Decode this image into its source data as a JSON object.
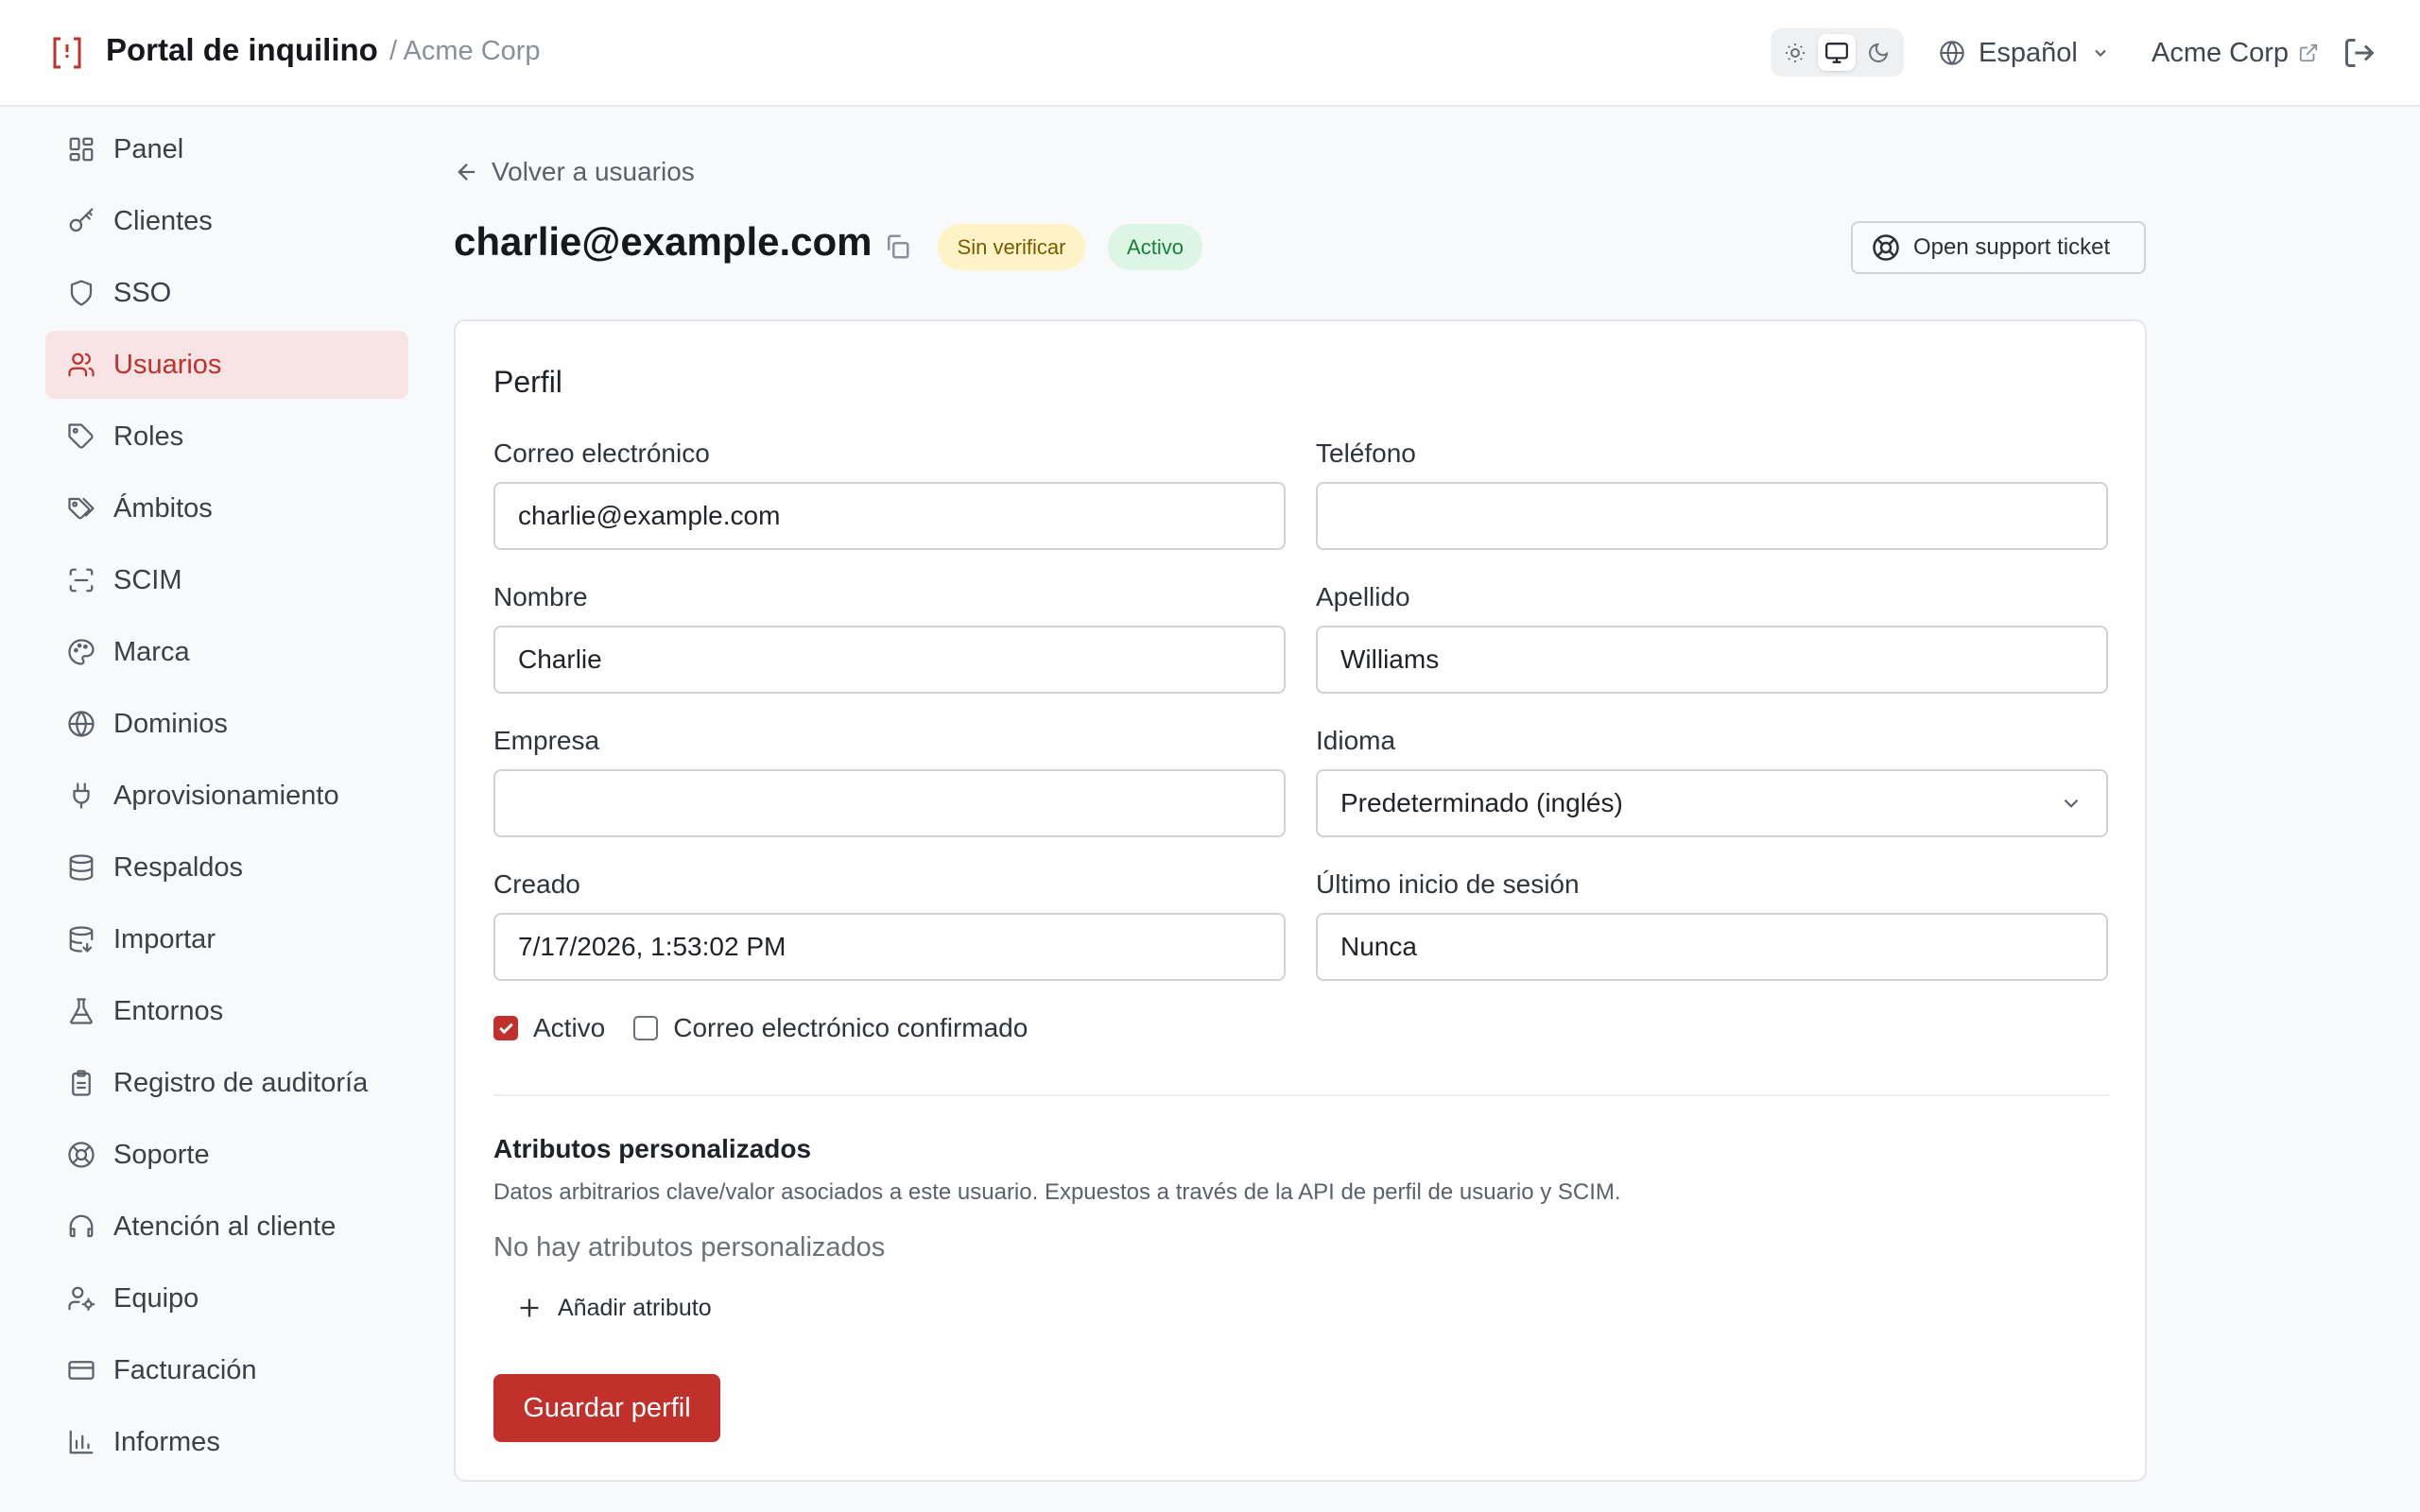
{
  "header": {
    "app_title": "Portal de inquilino",
    "org_crumb": "/ Acme Corp",
    "theme_options": [
      "light",
      "system",
      "dark"
    ],
    "theme_selected": "system",
    "language": "Español",
    "org_link": "Acme Corp"
  },
  "sidebar": {
    "items": [
      {
        "label": "Panel",
        "icon": "dashboard-icon"
      },
      {
        "label": "Clientes",
        "icon": "key-icon"
      },
      {
        "label": "SSO",
        "icon": "shield-icon"
      },
      {
        "label": "Usuarios",
        "icon": "users-icon",
        "active": true
      },
      {
        "label": "Roles",
        "icon": "tag-icon"
      },
      {
        "label": "Ámbitos",
        "icon": "tags-icon"
      },
      {
        "label": "SCIM",
        "icon": "scan-icon"
      },
      {
        "label": "Marca",
        "icon": "palette-icon"
      },
      {
        "label": "Dominios",
        "icon": "globe-icon"
      },
      {
        "label": "Aprovisionamiento",
        "icon": "plug-icon"
      },
      {
        "label": "Respaldos",
        "icon": "database-icon"
      },
      {
        "label": "Importar",
        "icon": "database-import-icon"
      },
      {
        "label": "Entornos",
        "icon": "flask-icon"
      },
      {
        "label": "Registro de auditoría",
        "icon": "clipboard-icon"
      },
      {
        "label": "Soporte",
        "icon": "lifebuoy-icon"
      },
      {
        "label": "Atención al cliente",
        "icon": "headset-icon"
      },
      {
        "label": "Equipo",
        "icon": "user-cog-icon"
      },
      {
        "label": "Facturación",
        "icon": "credit-card-icon"
      },
      {
        "label": "Informes",
        "icon": "bar-chart-icon"
      }
    ]
  },
  "main": {
    "back_label": "Volver a usuarios",
    "title": "charlie@example.com",
    "badges": {
      "unverified": "Sin verificar",
      "active": "Activo"
    },
    "support_button": "Open support ticket",
    "profile": {
      "heading": "Perfil",
      "email": {
        "label": "Correo electrónico",
        "value": "charlie@example.com"
      },
      "phone": {
        "label": "Teléfono",
        "value": ""
      },
      "first_name": {
        "label": "Nombre",
        "value": "Charlie"
      },
      "last_name": {
        "label": "Apellido",
        "value": "Williams"
      },
      "company": {
        "label": "Empresa",
        "value": ""
      },
      "language": {
        "label": "Idioma",
        "value": "Predeterminado (inglés)"
      },
      "created": {
        "label": "Creado",
        "value": "7/17/2026, 1:53:02 PM"
      },
      "last_login": {
        "label": "Último inicio de sesión",
        "value": "Nunca"
      },
      "active_checkbox": {
        "label": "Activo",
        "checked": true
      },
      "email_confirmed_checkbox": {
        "label": "Correo electrónico confirmado",
        "checked": false
      }
    },
    "custom_attributes": {
      "heading": "Atributos personalizados",
      "description": "Datos arbitrarios clave/valor asociados a este usuario. Expuestos a través de la API de perfil de usuario y SCIM.",
      "empty": "No hay atributos personalizados",
      "add_label": "Añadir atributo"
    },
    "save_button": "Guardar perfil"
  },
  "colors": {
    "accent": "#c0312b",
    "active_nav_bg": "#f8e4e4",
    "badge_unverified_bg": "#fdf3c6",
    "badge_active_bg": "#dcf5e4"
  }
}
